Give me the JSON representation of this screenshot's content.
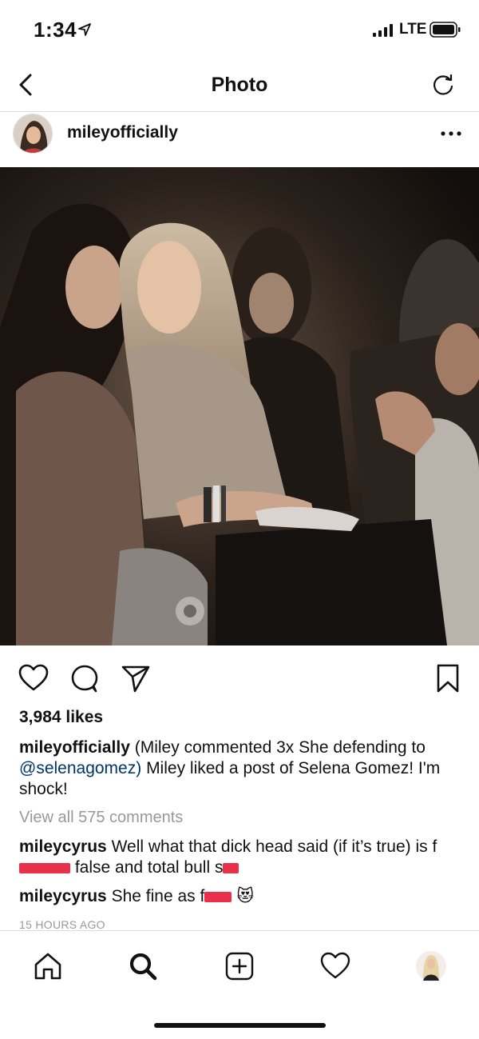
{
  "status": {
    "time": "1:34",
    "network": "LTE"
  },
  "nav": {
    "title": "Photo"
  },
  "post": {
    "username": "mileyofficially",
    "likes": "3,984 likes",
    "caption": {
      "user": "mileyofficially",
      "text_a": "(Miley commented 3x She defending to",
      "mention": "@selenagomez)",
      "text_b": " Miley liked a post of Selena Gomez! I'm shock!"
    },
    "view_all": "View all 575 comments",
    "comments": [
      {
        "user": "mileycyrus",
        "text_a": "Well what that dick head said (if it’s true) is f",
        "text_b": " false and total bull s"
      },
      {
        "user": "mileycyrus",
        "text_a": "She  fine as f",
        "emoji": "😻"
      }
    ],
    "time_ago": "15 HOURS AGO"
  },
  "colors": {
    "redaction": "#e8304a",
    "mention": "#003569",
    "muted": "#999999"
  },
  "icons": [
    "back-chevron-icon",
    "refresh-icon",
    "more-dots-icon",
    "heart-icon",
    "comment-icon",
    "share-icon",
    "bookmark-icon",
    "home-icon",
    "search-icon",
    "add-icon",
    "activity-heart-icon",
    "profile-avatar-icon"
  ]
}
